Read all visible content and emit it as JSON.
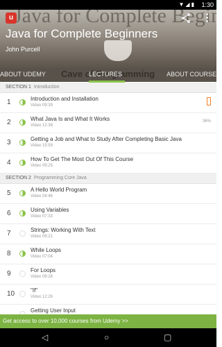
{
  "status_bar": {
    "time": "1:30"
  },
  "header": {
    "background_text": "Java for Complete Beginners",
    "title": "Java for Complete Beginners",
    "author": "John Purcell",
    "logo_text": "u"
  },
  "tabs": {
    "items": [
      "ABOUT UDEMY",
      "LECTURES",
      "ABOUT COURSE"
    ],
    "background_text": "Cave of Programming",
    "active": "LECTURES"
  },
  "sections": [
    {
      "label": "SECTION 1",
      "name": "Introduction",
      "lectures": [
        {
          "num": "1",
          "title": "Introduction and Installation",
          "video": "Video 09:39",
          "done": true,
          "icon": "phone-icon"
        },
        {
          "num": "2",
          "title": "What Java Is and What It Works",
          "video": "Video 12:38",
          "done": true,
          "progress": "36%"
        },
        {
          "num": "3",
          "title": "Getting a Job and What to Study After Completing Basic Java",
          "video": "Video 15:59",
          "done": true
        },
        {
          "num": "4",
          "title": "How To Get The Most Out Of This Course",
          "video": "Video 09:25",
          "done": true
        }
      ]
    },
    {
      "label": "SECTION 2",
      "name": "Programming Core Java",
      "lectures": [
        {
          "num": "5",
          "title": "A Hello World Program",
          "video": "Video 04:46",
          "done": true
        },
        {
          "num": "6",
          "title": "Using Variables",
          "video": "Video 07:33",
          "done": true
        },
        {
          "num": "7",
          "title": "Strings: Working With Text",
          "video": "Video 09:21",
          "done": false
        },
        {
          "num": "8",
          "title": "While Loops",
          "video": "Video 07:04",
          "done": true
        },
        {
          "num": "9",
          "title": "For Loops",
          "video": "Video 09:28",
          "done": false
        },
        {
          "num": "10",
          "title": "\"If\"",
          "video": "Video 12:26",
          "done": false
        },
        {
          "num": "",
          "title": "Getting User Input",
          "video": "",
          "done": false
        }
      ]
    }
  ],
  "banner": {
    "text": "Get access to over 10,000 courses from Udemy >>"
  },
  "colors": {
    "accent": "#8bc34a",
    "banner": "#7cb342",
    "phone_icon": "#f47b20"
  }
}
